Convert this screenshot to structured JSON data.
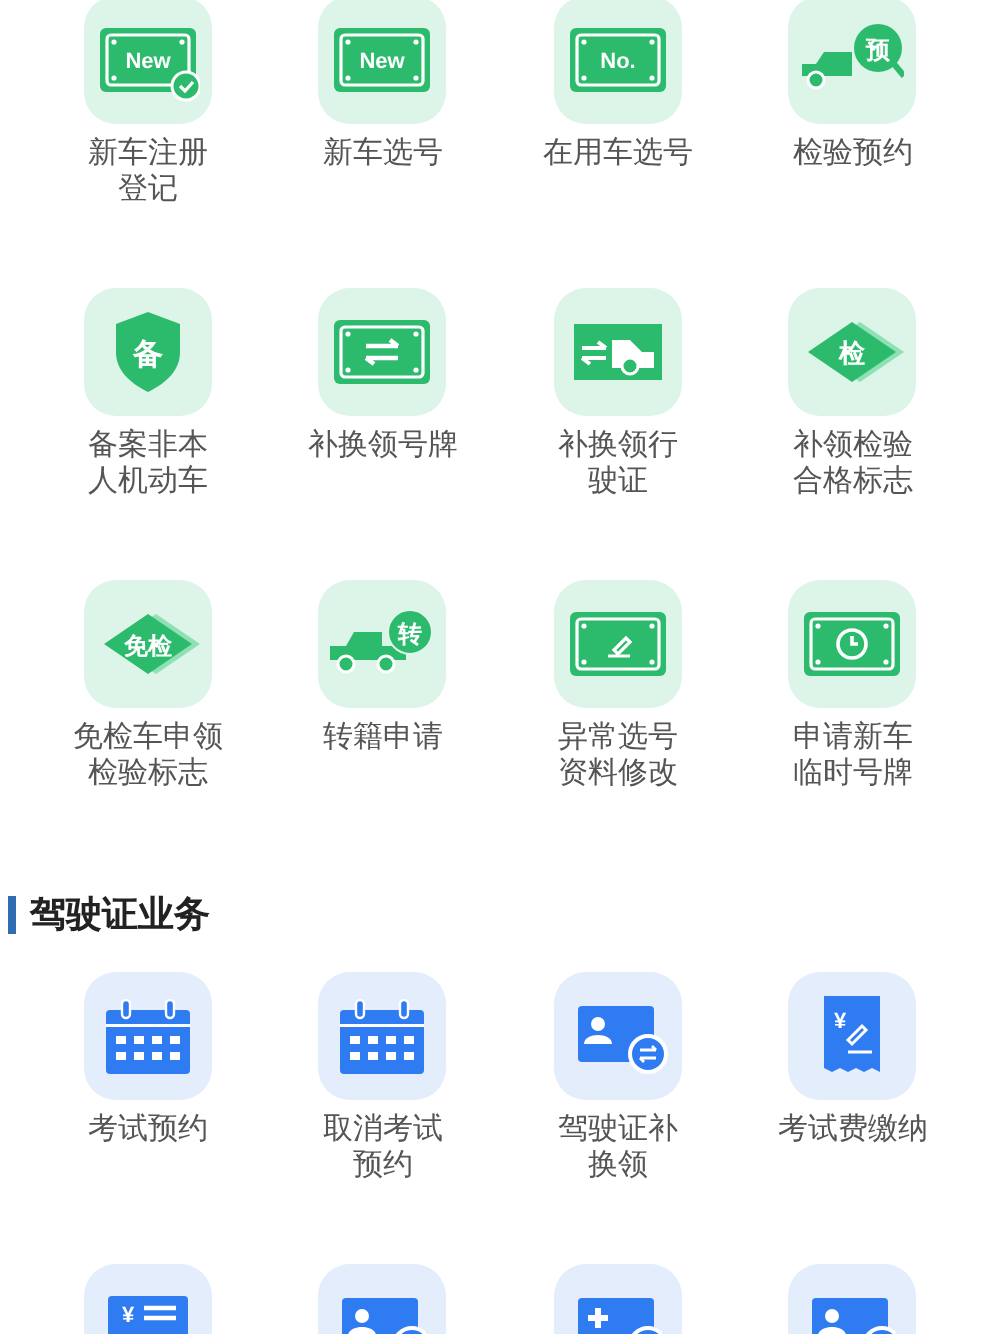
{
  "sections": [
    {
      "items": [
        {
          "kind": "plate-check",
          "badge": "New",
          "lines": [
            "新车注册",
            "登记"
          ]
        },
        {
          "kind": "plate",
          "badge": "New",
          "lines": [
            "新车选号"
          ]
        },
        {
          "kind": "plate",
          "badge": "No.",
          "lines": [
            "在用车选号"
          ]
        },
        {
          "kind": "truck-search",
          "badge": "预",
          "lines": [
            "检验预约"
          ]
        },
        {
          "kind": "shield",
          "badge": "备",
          "lines": [
            "备案非本",
            "人机动车"
          ]
        },
        {
          "kind": "plate-swap",
          "lines": [
            "补换领号牌"
          ]
        },
        {
          "kind": "swap-truck",
          "lines": [
            "补换领行",
            "驶证"
          ]
        },
        {
          "kind": "diamond",
          "badge": "检",
          "lines": [
            "补领检验",
            "合格标志"
          ]
        },
        {
          "kind": "diamond",
          "badge": "免检",
          "lines": [
            "免检车申领",
            "检验标志"
          ]
        },
        {
          "kind": "truck-badge",
          "badge": "转",
          "lines": [
            "转籍申请"
          ]
        },
        {
          "kind": "plate-pen",
          "lines": [
            "异常选号",
            "资料修改"
          ]
        },
        {
          "kind": "plate-clock",
          "lines": [
            "申请新车",
            "临时号牌"
          ]
        }
      ]
    },
    {
      "title": "驾驶证业务",
      "items": [
        {
          "kind": "calendar",
          "lines": [
            "考试预约"
          ]
        },
        {
          "kind": "calendar-x",
          "lines": [
            "取消考试",
            "预约"
          ]
        },
        {
          "kind": "card-swap",
          "lines": [
            "驾驶证补",
            "换领"
          ]
        },
        {
          "kind": "receipt",
          "badge": "¥",
          "lines": [
            "考试费缴纳"
          ]
        },
        {
          "kind": "fee-list",
          "badge": "¥"
        },
        {
          "kind": "card-person"
        },
        {
          "kind": "card-plus"
        },
        {
          "kind": "card-person"
        }
      ]
    }
  ]
}
